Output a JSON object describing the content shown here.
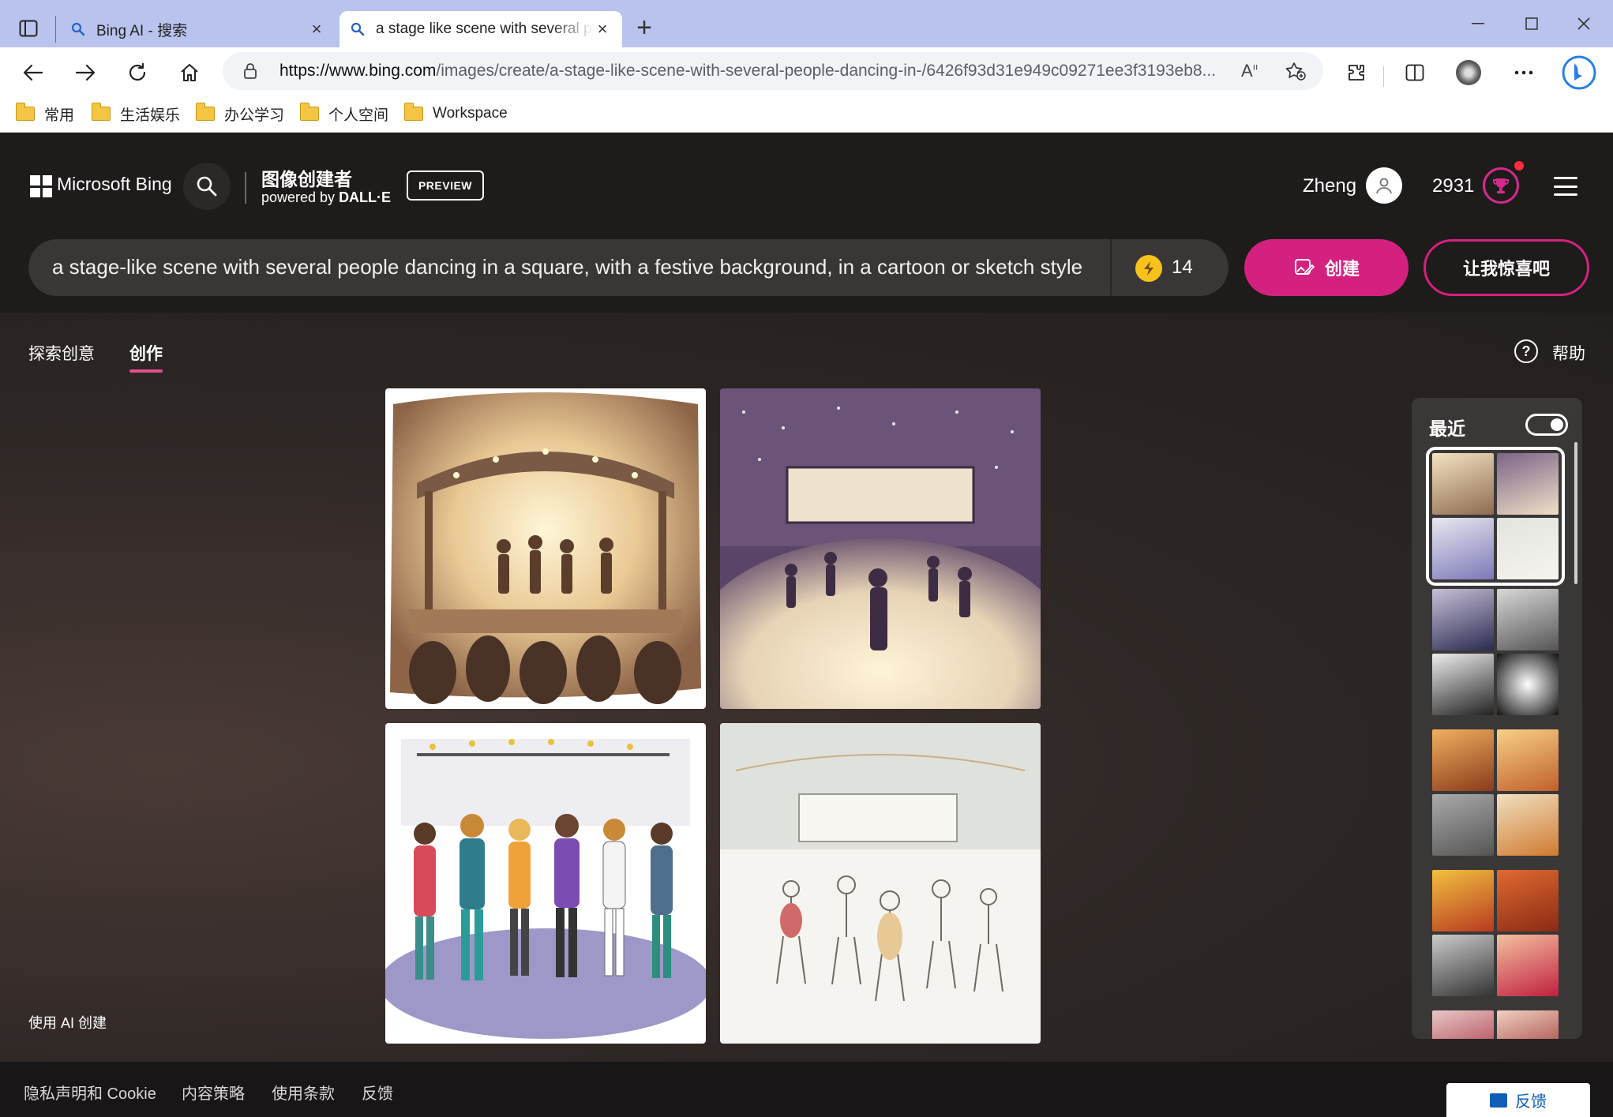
{
  "browser": {
    "tabs": [
      {
        "label": "Bing AI - 搜索",
        "active": false
      },
      {
        "label": "a stage like scene with several pe",
        "active": true
      }
    ],
    "url_host": "https://www.bing.com",
    "url_path": "/images/create/a-stage-like-scene-with-several-people-dancing-in-/6426f93d31e949c09271ee3f3193eb8...",
    "bookmarks": [
      "常用",
      "生活娱乐",
      "办公学习",
      "个人空间",
      "Workspace"
    ]
  },
  "header": {
    "brand": "Microsoft Bing",
    "creator_title": "图像创建者",
    "powered_prefix": "powered by ",
    "powered_model": "DALL·E",
    "preview_badge": "PREVIEW",
    "user_name": "Zheng",
    "points": "2931"
  },
  "prompt": {
    "text": "a stage-like scene with several people dancing in a square, with a festive background, in a cartoon or sketch style",
    "boost_count": "14",
    "create_label": "创建",
    "surprise_label": "让我惊喜吧"
  },
  "nav": {
    "tabs": [
      "探索创意",
      "创作"
    ],
    "active_tab": "创作",
    "help_label": "帮助"
  },
  "recent": {
    "title": "最近",
    "toggle_on": true
  },
  "ai_note": "使用 AI 创建",
  "footer": {
    "links": [
      "隐私声明和 Cookie",
      "内容策略",
      "使用条款",
      "反馈"
    ],
    "feedback_button": "反馈"
  },
  "colors": {
    "accent": "#d4217f",
    "header_bg": "#1e1b1b",
    "tabbar_bg": "#b9c3ee"
  }
}
